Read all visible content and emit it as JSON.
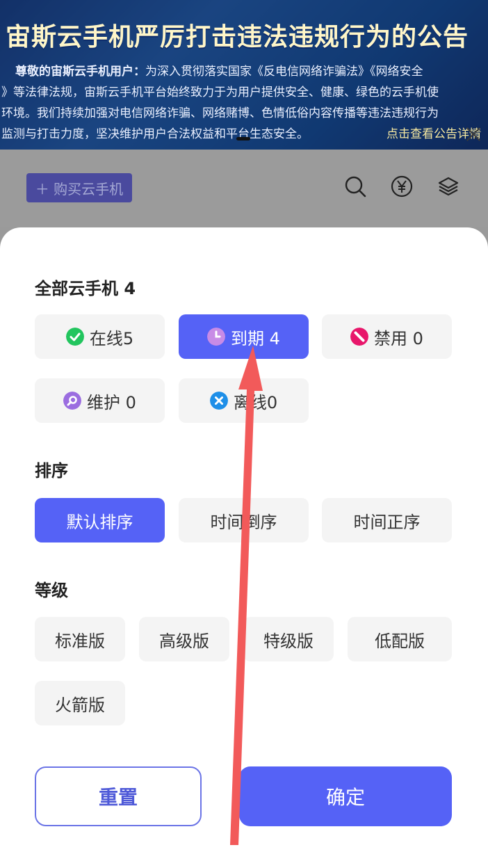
{
  "banner": {
    "title": "宙斯云手机严厉打击违法违规行为的公告",
    "greeting": "尊敬的宙斯云手机用户：",
    "line1_rest": "为深入贯彻落实国家《反电信网络诈骗法》《网络安全",
    "line2": "》等法律法规，宙斯云手机平台始终致力于为用户提供安全、健康、绿色的云手机使",
    "line3": "环境。我们持续加强对电信网络诈骗、网络赌博、色情低俗内容传播等违法违规行为",
    "line4": "监测与打击力度，坚决维护用户合法权益和平台生态安全。",
    "link": "点击查看公告详情"
  },
  "toolbar": {
    "buy_label": "＋ 购买云手机",
    "icons": [
      "search-icon",
      "yuan-icon",
      "layers-icon"
    ]
  },
  "sheet": {
    "all_title": "全部云手机 4",
    "status_chips": [
      {
        "label": "在线5",
        "icon": "check-circle-icon",
        "color": "#22c55e",
        "active": false
      },
      {
        "label": "到期 4",
        "icon": "clock-icon",
        "color": "#c88be6",
        "active": true
      },
      {
        "label": "禁用 0",
        "icon": "forbidden-icon",
        "color": "#e8176b",
        "active": false
      },
      {
        "label": "维护 0",
        "icon": "wrench-icon",
        "color": "#9b6de0",
        "active": false
      },
      {
        "label": "离线0",
        "icon": "x-circle-icon",
        "color": "#1e8fe8",
        "active": false
      }
    ],
    "sort_title": "排序",
    "sort_chips": [
      {
        "label": "默认排序",
        "active": true
      },
      {
        "label": "时间倒序",
        "active": false
      },
      {
        "label": "时间正序",
        "active": false
      }
    ],
    "level_title": "等级",
    "level_chips": [
      "标准版",
      "高级版",
      "特级版",
      "低配版",
      "火箭版"
    ],
    "reset_label": "重置",
    "confirm_label": "确定"
  },
  "colors": {
    "accent": "#5562f6",
    "annotation_arrow": "#f25a5a"
  }
}
